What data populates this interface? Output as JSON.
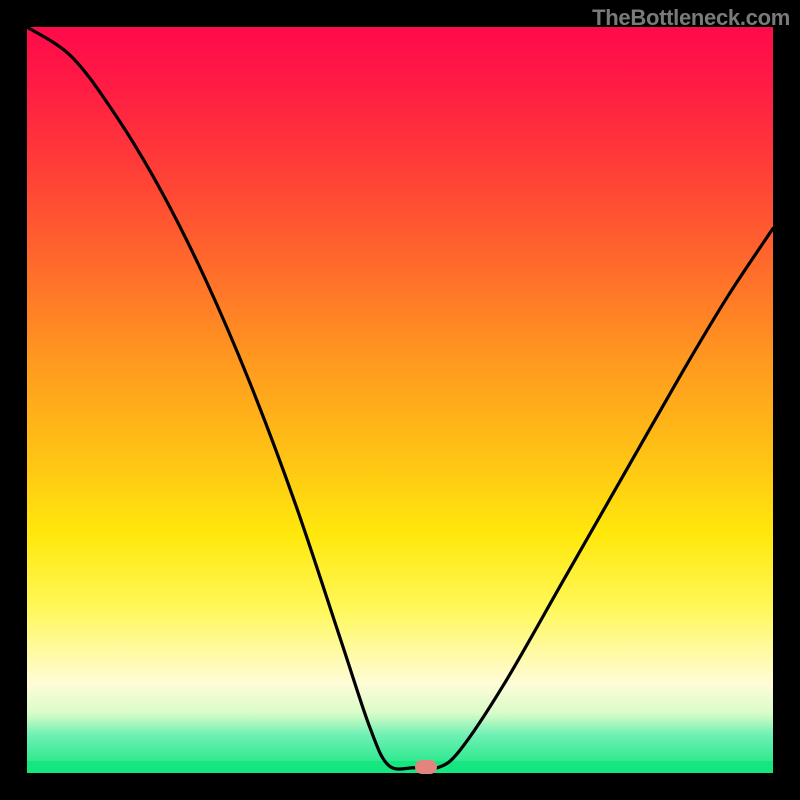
{
  "attribution": "TheBottleneck.com",
  "chart_data": {
    "type": "line",
    "title": "",
    "xlabel": "",
    "ylabel": "",
    "xlim": [
      0,
      100
    ],
    "ylim": [
      0,
      100
    ],
    "points": [
      {
        "x": 0,
        "y": 100
      },
      {
        "x": 6,
        "y": 96
      },
      {
        "x": 12,
        "y": 88
      },
      {
        "x": 18,
        "y": 78
      },
      {
        "x": 24,
        "y": 66
      },
      {
        "x": 30,
        "y": 52
      },
      {
        "x": 36,
        "y": 36
      },
      {
        "x": 42,
        "y": 18
      },
      {
        "x": 46,
        "y": 6
      },
      {
        "x": 48.5,
        "y": 1
      },
      {
        "x": 52,
        "y": 0.7
      },
      {
        "x": 55,
        "y": 0.7
      },
      {
        "x": 58,
        "y": 3
      },
      {
        "x": 64,
        "y": 12
      },
      {
        "x": 72,
        "y": 26
      },
      {
        "x": 80,
        "y": 40
      },
      {
        "x": 88,
        "y": 54
      },
      {
        "x": 94,
        "y": 64
      },
      {
        "x": 100,
        "y": 73
      }
    ],
    "marker": {
      "x": 53.5,
      "y": 0.8
    },
    "gradient_stops": [
      {
        "pos": 0,
        "color": "#ff0a4a"
      },
      {
        "pos": 50,
        "color": "#ffe80c"
      },
      {
        "pos": 88,
        "color": "#fffcd8"
      },
      {
        "pos": 100,
        "color": "#16e67f"
      }
    ]
  }
}
